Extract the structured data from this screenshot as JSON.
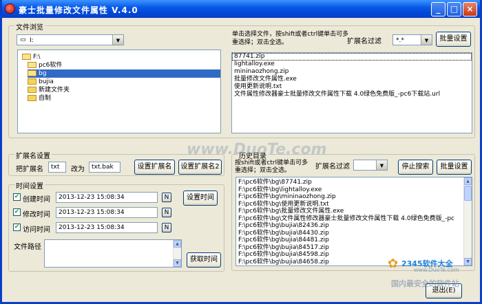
{
  "window": {
    "title": "豪士批量修改文件属性  V.4.0",
    "controls": {
      "minimize": "_",
      "maximize": "□",
      "close": "×"
    }
  },
  "browse": {
    "group_title": "文件浏览",
    "drive_value": "I:",
    "hint": "单击选择文件，按shift或者ctrl键单击可多重选择；双击全选。",
    "ext_filter_label": "扩展名过滤",
    "ext_filter_value": "*.*",
    "batch_button": "批量设置",
    "tree": [
      {
        "label": "F:\\",
        "indent": 0,
        "selected": false
      },
      {
        "label": "pc6软件",
        "indent": 1,
        "selected": false
      },
      {
        "label": "bg",
        "indent": 1,
        "selected": true
      },
      {
        "label": "bujia",
        "indent": 1,
        "selected": false
      },
      {
        "label": "新建文件夹",
        "indent": 1,
        "selected": false
      },
      {
        "label": "自制",
        "indent": 1,
        "selected": false
      }
    ],
    "files": [
      "87741.zip",
      "lightalloy.exe",
      "mininaozhong.zip",
      "批量修改文件属性.exe",
      "使用更新说明.txt",
      "文件属性修改器豪士批量修改文件属性下载 4.0绿色免费版_-pc6下载站.url"
    ]
  },
  "ext_settings": {
    "group_title": "扩展名设置",
    "from_label": "把扩展名",
    "from_value": "txt",
    "to_label": "改为",
    "to_value": "txt.bak",
    "set_button": "设置扩展名",
    "set_button2": "设置扩展名2"
  },
  "time_settings": {
    "group_title": "时间设置",
    "rows": [
      {
        "label": "创建时间",
        "checked": true,
        "value": "2013-12-23 15:08:34",
        "n": "N"
      },
      {
        "label": "修改时间",
        "checked": true,
        "value": "2013-12-23 15:08:34",
        "n": "N"
      },
      {
        "label": "访问时间",
        "checked": true,
        "value": "2013-12-23 15:08:34",
        "n": "N"
      }
    ],
    "set_button": "设置时间",
    "path_label": "文件路径",
    "get_button": "获取时间"
  },
  "history": {
    "group_title": "历史目录",
    "hint": "按shift或者ctrl键单击可多重选择；双击全选。",
    "ext_filter_label": "扩展名过滤",
    "stop_button": "停止搜索",
    "batch_button": "批量设置",
    "items": [
      "F:\\pc6软件\\bg\\87741.zip",
      "F:\\pc6软件\\bg\\lightalloy.exe",
      "F:\\pc6软件\\bg\\mininaozhong.zip",
      "F:\\pc6软件\\bg\\使用更新说明.txt",
      "F:\\pc6软件\\bg\\批量修改文件属性.exe",
      "F:\\pc6软件\\bg\\文件属性修改器豪士批量修改文件属性下载 4.0绿色免费版_-pc",
      "F:\\pc6软件\\bg\\bujia\\82436.zip",
      "F:\\pc6软件\\bg\\bujia\\84430.zip",
      "F:\\pc6软件\\bg\\bujia\\84481.zip",
      "F:\\pc6软件\\bg\\bujia\\84517.zip",
      "F:\\pc6软件\\bg\\bujia\\84598.zip",
      "F:\\pc6软件\\bg\\bujia\\84658.zip"
    ]
  },
  "exit_button": "退出(E)",
  "watermarks": {
    "center": "www.DuoTe.com",
    "brand": "2345软件大全",
    "brand_url": "www.DuoTe.com",
    "bottom": "国内最安全的软件站"
  },
  "colors": {
    "titlebar": "#0a5ae8",
    "selection": "#316ac5",
    "face": "#ece9d8"
  }
}
